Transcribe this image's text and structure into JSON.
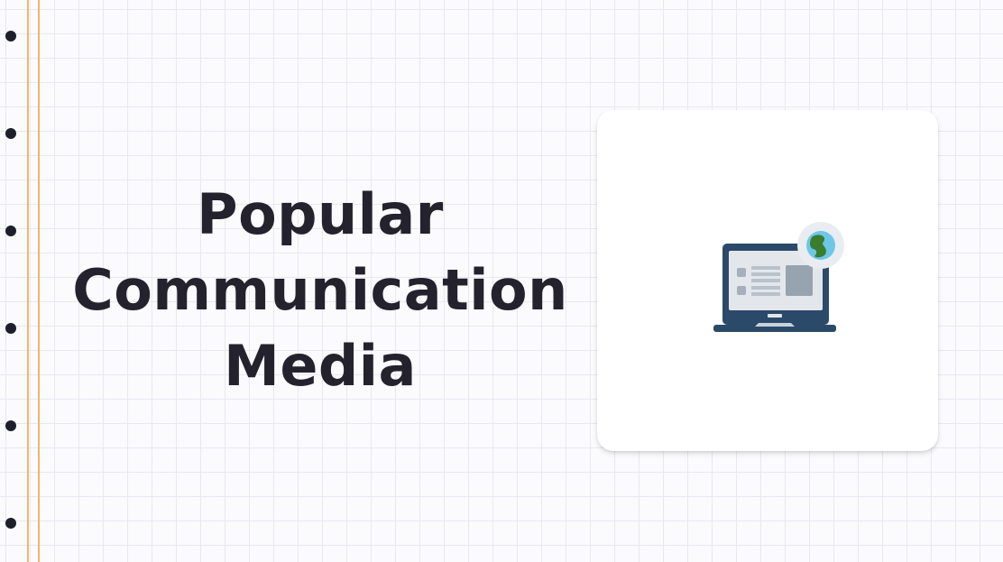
{
  "title": {
    "line1": "Popular",
    "line2": "Communication",
    "line3": "Media"
  },
  "illustration": {
    "icon": "laptop-with-globe-icon"
  },
  "colors": {
    "background": "#fbfbfd",
    "grid": "#e8e8f0",
    "margin_line": "#f2b56a",
    "title_text": "#23222d",
    "laptop_dark": "#2b4a6a",
    "globe_water": "#6ec6e8",
    "globe_land": "#3a7d2c"
  }
}
